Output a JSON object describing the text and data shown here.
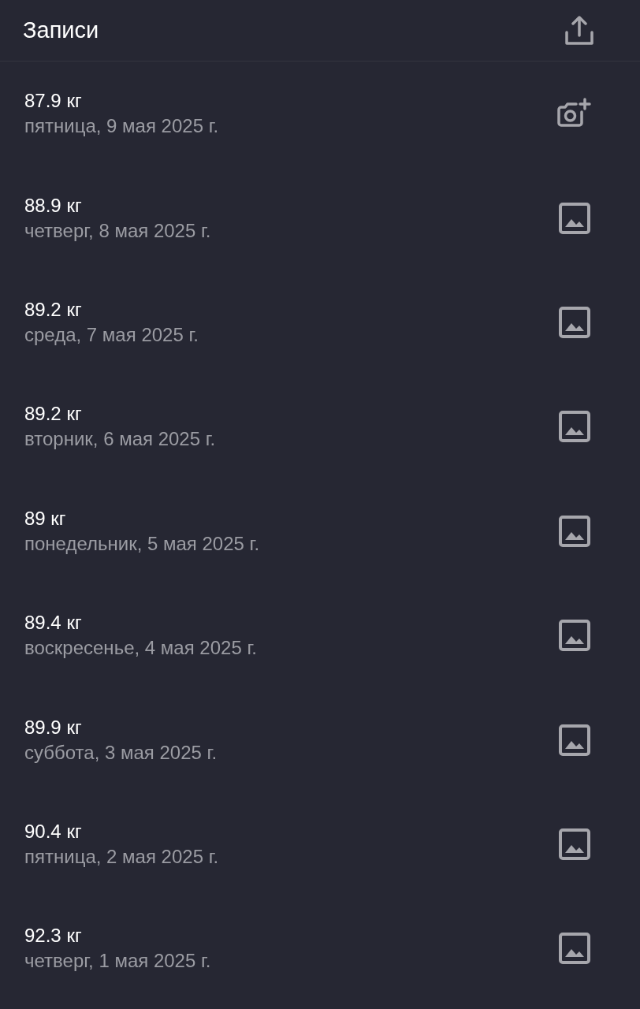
{
  "header": {
    "title": "Записи"
  },
  "entries": [
    {
      "weight": "87.9 кг",
      "date": "пятница, 9 мая 2025 г.",
      "kind": "add-photo"
    },
    {
      "weight": "88.9 кг",
      "date": "четверг, 8 мая 2025 г.",
      "kind": "photo"
    },
    {
      "weight": "89.2 кг",
      "date": "среда, 7 мая 2025 г.",
      "kind": "photo"
    },
    {
      "weight": "89.2 кг",
      "date": "вторник, 6 мая 2025 г.",
      "kind": "photo"
    },
    {
      "weight": "89 кг",
      "date": "понедельник, 5 мая 2025 г.",
      "kind": "photo"
    },
    {
      "weight": "89.4 кг",
      "date": "воскресенье, 4 мая 2025 г.",
      "kind": "photo"
    },
    {
      "weight": "89.9 кг",
      "date": "суббота, 3 мая 2025 г.",
      "kind": "photo"
    },
    {
      "weight": "90.4 кг",
      "date": "пятница, 2 мая 2025 г.",
      "kind": "photo"
    },
    {
      "weight": "92.3 кг",
      "date": "четверг, 1 мая 2025 г.",
      "kind": "photo"
    }
  ]
}
